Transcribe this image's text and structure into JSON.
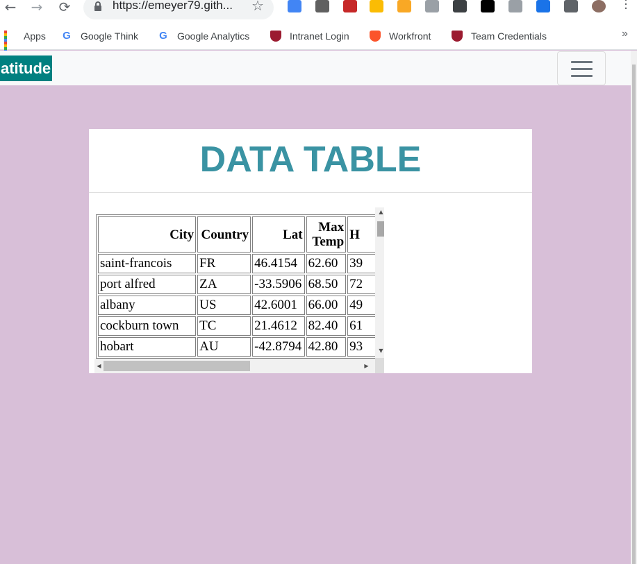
{
  "browser": {
    "url": "https://emeyer79.gith...",
    "nav": {
      "back": "←",
      "forward": "→",
      "reload": "⟳"
    },
    "star": "☆",
    "extension_colors": [
      "#4285f4",
      "#606060",
      "#c62828",
      "#fbbc04",
      "#f9a825",
      "#9aa0a6",
      "#3c4043",
      "#000000",
      "#9aa0a6",
      "#1a73e8",
      "#5f6368",
      "#8d6e63"
    ],
    "menu_icon": "vertical-dots-icon"
  },
  "bookmarks": {
    "items": [
      {
        "label": "Apps",
        "icon": "apps-grid-icon"
      },
      {
        "label": "Google Think",
        "icon": "google-icon"
      },
      {
        "label": "Google Analytics",
        "icon": "google-icon"
      },
      {
        "label": "Intranet Login",
        "icon": "shield-icon"
      },
      {
        "label": "Workfront",
        "icon": "brave-lion-icon"
      },
      {
        "label": "Team Credentials",
        "icon": "shield-icon"
      }
    ],
    "more": "»"
  },
  "site": {
    "brand": "atitude",
    "brand_color": "#008080",
    "background": "#d8bfd8",
    "toggler_icon": "hamburger-icon"
  },
  "card": {
    "title": "DATA TABLE",
    "title_color": "#3a93a3"
  },
  "table": {
    "headers": [
      "City",
      "Country",
      "Lat",
      "Max Temp",
      "H"
    ],
    "rows": [
      [
        "saint-francois",
        "FR",
        "46.4154",
        "62.60",
        "39"
      ],
      [
        "port alfred",
        "ZA",
        "-33.5906",
        "68.50",
        "72"
      ],
      [
        "albany",
        "US",
        "42.6001",
        "66.00",
        "49"
      ],
      [
        "cockburn town",
        "TC",
        "21.4612",
        "82.40",
        "61"
      ],
      [
        "hobart",
        "AU",
        "-42.8794",
        "42.80",
        "93"
      ]
    ]
  }
}
